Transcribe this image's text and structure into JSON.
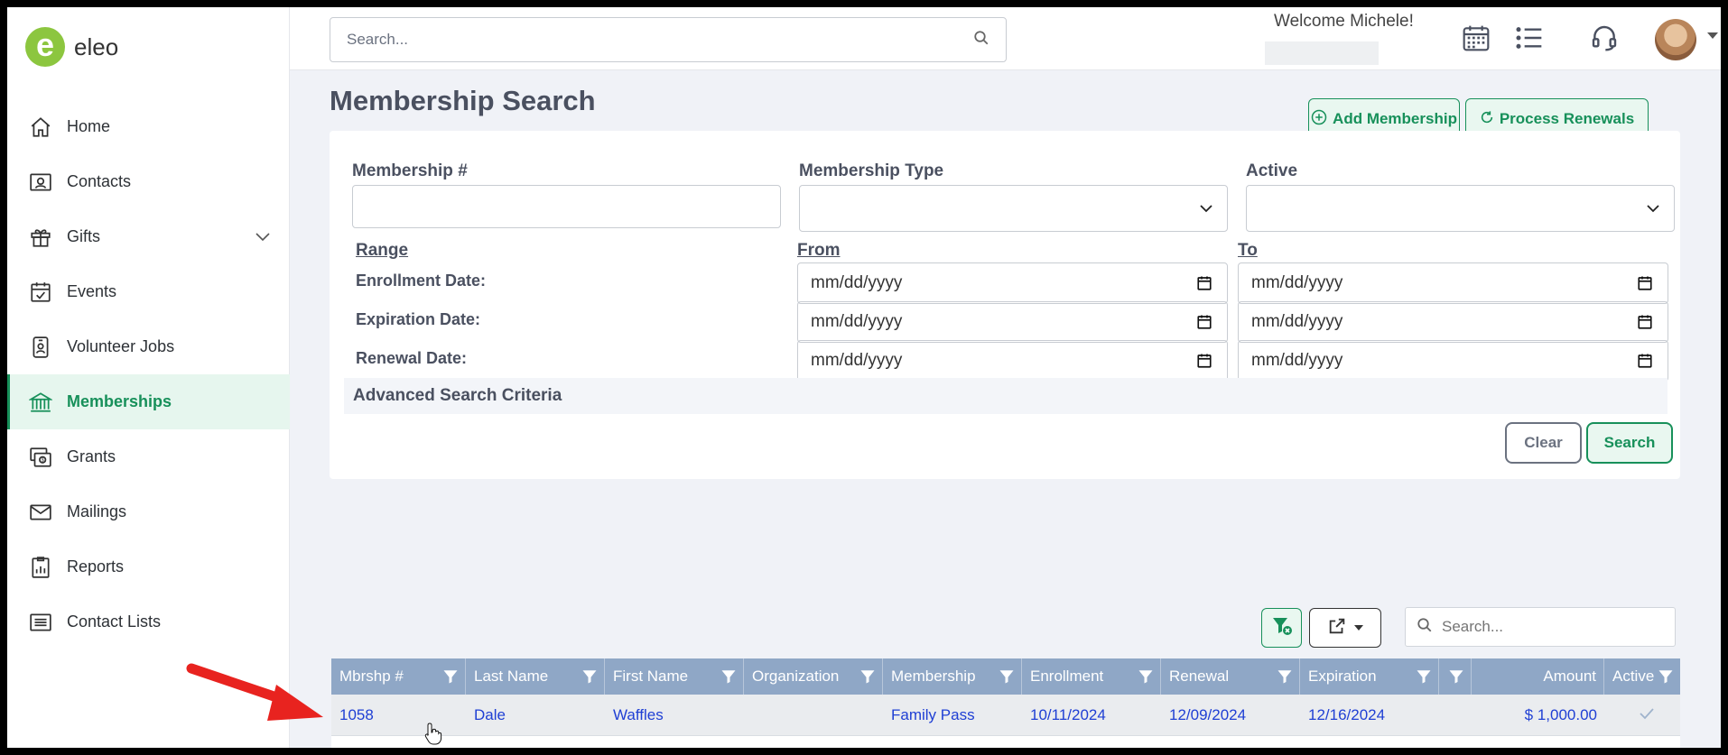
{
  "app": {
    "name": "eleo",
    "logo_letter": "e",
    "accent": "#17905a",
    "logo_color": "#8cc63f"
  },
  "sidebar": {
    "items": [
      {
        "label": "Home",
        "icon": "home-icon"
      },
      {
        "label": "Contacts",
        "icon": "contact-card-icon"
      },
      {
        "label": "Gifts",
        "icon": "gift-icon",
        "expandable": true
      },
      {
        "label": "Events",
        "icon": "calendar-check-icon"
      },
      {
        "label": "Volunteer Jobs",
        "icon": "badge-icon"
      },
      {
        "label": "Memberships",
        "icon": "bank-icon",
        "active": true
      },
      {
        "label": "Grants",
        "icon": "money-cards-icon"
      },
      {
        "label": "Mailings",
        "icon": "envelope-icon"
      },
      {
        "label": "Reports",
        "icon": "report-chart-icon"
      },
      {
        "label": "Contact Lists",
        "icon": "list-icon"
      }
    ]
  },
  "topbar": {
    "search_placeholder": "Search...",
    "welcome": "Welcome Michele!",
    "icons": [
      "calendar-grid-icon",
      "task-list-icon",
      "headset-icon",
      "avatar",
      "chevron-down-icon"
    ]
  },
  "page": {
    "title": "Membership Search",
    "add_membership": "Add Membership",
    "process_renewals": "Process Renewals"
  },
  "form": {
    "membership_no_label": "Membership #",
    "membership_type_label": "Membership Type",
    "active_label": "Active",
    "range_label": "Range",
    "from_label": "From",
    "to_label": "To",
    "enrollment_label": "Enrollment Date:",
    "expiration_label": "Expiration Date:",
    "renewal_label": "Renewal Date:",
    "date_placeholder": "mm/dd/yyyy",
    "advanced": "Advanced Search Criteria",
    "clear": "Clear",
    "search": "Search"
  },
  "grid": {
    "search_placeholder": "Search...",
    "columns": [
      "Mbrshp #",
      "Last Name",
      "First Name",
      "Organization",
      "Membership",
      "Enrollment",
      "Renewal",
      "Expiration",
      "",
      "Amount",
      "Active"
    ],
    "rows": [
      {
        "mbrshp": "1058",
        "last": "Dale",
        "first": "Waffles",
        "org": "",
        "membership": "Family Pass",
        "enrollment": "10/11/2024",
        "renewal": "12/09/2024",
        "expiration": "12/16/2024",
        "amount": "$ 1,000.00",
        "active": true
      }
    ]
  }
}
